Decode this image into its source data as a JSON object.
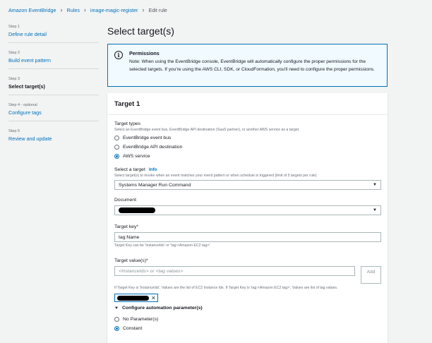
{
  "breadcrumb": {
    "items": [
      "Amazon EventBridge",
      "Rules",
      "image-magic-register",
      "Edit rule"
    ]
  },
  "steps": [
    {
      "num": "Step 1",
      "title": "Define rule detail"
    },
    {
      "num": "Step 2",
      "title": "Build event pattern"
    },
    {
      "num": "Step 3",
      "title": "Select target(s)"
    },
    {
      "num": "Step 4 - optional",
      "title": "Configure tags"
    },
    {
      "num": "Step 5",
      "title": "Review and update"
    }
  ],
  "page_title": "Select target(s)",
  "alert": {
    "title": "Permissions",
    "body": "Note: When using the EventBridge console, EventBridge will automatically configure the proper permissions for the selected targets. If you're using the AWS CLI, SDK, or CloudFormation, you'll need to configure the proper permissions."
  },
  "target": {
    "header": "Target 1",
    "types": {
      "label": "Target types",
      "desc": "Select an EventBridge event bus, EventBridge API destination (SaaS partner), or another AWS service as a target.",
      "options": [
        "EventBridge event bus",
        "EventBridge API destination",
        "AWS service"
      ],
      "selected": "AWS service"
    },
    "select_target": {
      "label": "Select a target",
      "info": "Info",
      "desc": "Select target(s) to invoke when an event matches your event pattern or when schedule is triggered (limit of 5 targets per rule)",
      "value": "Systems Manager Run Command"
    },
    "document": {
      "label": "Document"
    },
    "target_key": {
      "label": "Target key*",
      "value": "tag:Name",
      "desc": "Target Key can be 'InstanceIds' or 'tag:<Amazon EC2 tag>'."
    },
    "target_values": {
      "label": "Target value(s)*",
      "placeholder": "<InstanceIds> or <tag values>",
      "add_label": "Add",
      "desc": "If Target Key is 'InstanceIds', Values are the list of EC2 Instance Ids. If Target Key is 'tag:<Amazon EC2 tag>', Values are list of tag values."
    },
    "automation": {
      "label": "Configure automation parameter(s)",
      "options": [
        "No Parameter(s)",
        "Constant"
      ],
      "selected": "Constant"
    }
  },
  "colors": {
    "link": "#0073bb",
    "page_bg": "#f2f3f3",
    "info_bg": "#f1faff"
  }
}
